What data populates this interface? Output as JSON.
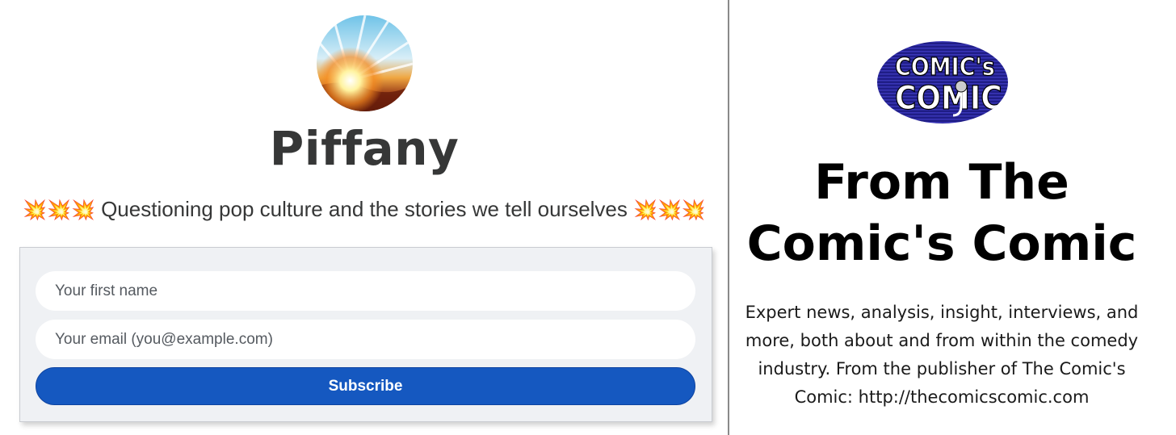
{
  "publication": {
    "title": "Piffany",
    "tagline": "Questioning pop culture and the stories we tell ourselves",
    "tagline_emoji": "💥💥💥"
  },
  "subscribe_form": {
    "first_name_placeholder": "Your first name",
    "email_placeholder": "Your email (you@example.com)",
    "subscribe_label": "Subscribe"
  },
  "recommendation": {
    "logo_text_line1": "COMIC's",
    "logo_text_line2": "COMIC",
    "title": "From The Comic's Comic",
    "description": "Expert news, analysis, insight, interviews, and more, both about and from within the comedy industry. From the publisher of The Comic's Comic: http://thecomicscomic.com"
  },
  "colors": {
    "button_blue": "#1558c0",
    "title_text": "#363737",
    "form_background": "#eff1f4"
  }
}
